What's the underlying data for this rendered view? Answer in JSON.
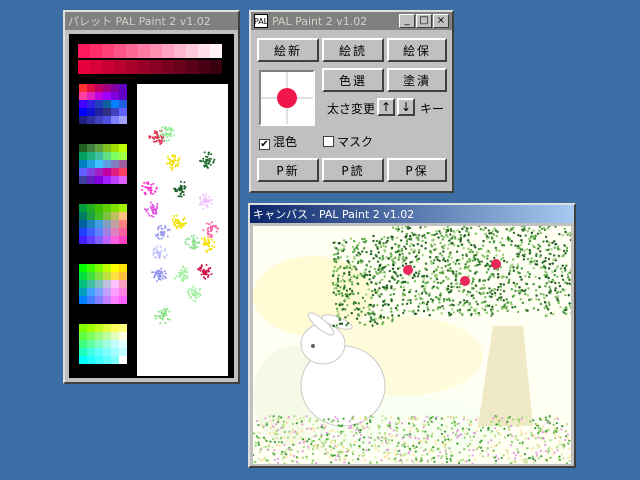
{
  "palette_window": {
    "title": "パレット PAL Paint 2 v1.02",
    "top_strip": [
      "#ff1a5e",
      "#ff2d6b",
      "#ff4079",
      "#ff5487",
      "#ff6795",
      "#ff7ba3",
      "#ff8fb1",
      "#ffa3c0",
      "#ffb7ce",
      "#ffcbdc",
      "#ffdfea",
      "#fff3f8"
    ],
    "bottom_strip": [
      "#e8003c",
      "#d90038",
      "#c90034",
      "#b90030",
      "#a9002c",
      "#990028",
      "#890024",
      "#790020",
      "#69001c",
      "#590018",
      "#490014",
      "#390010"
    ],
    "groups": [
      [
        "#ff3030",
        "#e01040",
        "#c00060",
        "#a00080",
        "#8000a0",
        "#6000c0",
        "#ff40a0",
        "#e020c0",
        "#c000e0",
        "#a000ff",
        "#8000e0",
        "#6000c0",
        "#4000ff",
        "#3020e0",
        "#2040c0",
        "#1060a0",
        "#0080ff",
        "#2060e0",
        "#0000ff",
        "#1010d0",
        "#2020a0",
        "#303080",
        "#4040c0",
        "#6060ff",
        "#202080",
        "#3030a0",
        "#4040c0",
        "#5050e0",
        "#8080ff",
        "#a0a0ff"
      ],
      [
        "#206020",
        "#408040",
        "#60a040",
        "#80c020",
        "#a0e000",
        "#c0ff00",
        "#00a060",
        "#20b080",
        "#40c0a0",
        "#60e080",
        "#80ff60",
        "#a0ff40",
        "#0080c0",
        "#20a0e0",
        "#40c0ff",
        "#60a0e0",
        "#8080c0",
        "#a060a0",
        "#6060ff",
        "#8040e0",
        "#a020c0",
        "#c000a0",
        "#e02080",
        "#ff4060",
        "#4040a0",
        "#6020c0",
        "#8000e0",
        "#a020ff",
        "#c040ff",
        "#e060ff"
      ],
      [
        "#00a040",
        "#20b020",
        "#40c000",
        "#60d000",
        "#80e000",
        "#a0f000",
        "#008060",
        "#20a040",
        "#40c020",
        "#80c040",
        "#c0c060",
        "#ffc080",
        "#0060a0",
        "#2080c0",
        "#40a0e0",
        "#80a0c0",
        "#c0a0a0",
        "#ff8080",
        "#2040ff",
        "#4060ff",
        "#6080ff",
        "#a080e0",
        "#e080c0",
        "#ff60a0",
        "#4020ff",
        "#6040ff",
        "#8060ff",
        "#c060ff",
        "#ff60e0",
        "#ff40c0"
      ],
      [
        "#00ff00",
        "#40ff00",
        "#80ff00",
        "#c0ff00",
        "#ffff00",
        "#ffe000",
        "#00e040",
        "#40e040",
        "#80e040",
        "#c0e040",
        "#ffe040",
        "#ffc040",
        "#00c080",
        "#40c0a0",
        "#80c0c0",
        "#c0c0e0",
        "#ffc0ff",
        "#ffa0c0",
        "#00a0c0",
        "#40a0ff",
        "#80a0ff",
        "#c0a0ff",
        "#ffa0ff",
        "#ff80e0",
        "#0080ff",
        "#4080ff",
        "#8080ff",
        "#c080ff",
        "#ff80ff",
        "#ff60ff"
      ],
      [
        "#80ff00",
        "#a0ff00",
        "#c0ff20",
        "#e0ff40",
        "#ffff60",
        "#ffff80",
        "#60ff40",
        "#80ff60",
        "#a0ff80",
        "#c0ffa0",
        "#e0ffc0",
        "#ffffe0",
        "#40ff80",
        "#60ffa0",
        "#80ffc0",
        "#a0ffe0",
        "#c0ffff",
        "#e0ffff",
        "#20ffc0",
        "#40ffe0",
        "#60ffff",
        "#80ffff",
        "#a0ffff",
        "#c0ffff",
        "#00ffff",
        "#20ffff",
        "#40ffff",
        "#60ffff",
        "#80ffff",
        "#ffffff"
      ]
    ],
    "blobs": [
      {
        "color": "#e0284a"
      },
      {
        "color": "#f2e000"
      },
      {
        "color": "#1f6b2e"
      },
      {
        "color": "#ff33cc"
      },
      {
        "color": "#1f5f2a"
      },
      {
        "color": "#e055e0"
      },
      {
        "color": "#f0c0ff"
      },
      {
        "color": "#f2e000"
      },
      {
        "color": "#ff66aa"
      },
      {
        "color": "#a0a0f0"
      },
      {
        "color": "#90e090"
      },
      {
        "color": "#f2e000"
      },
      {
        "color": "#c0c0ff"
      },
      {
        "color": "#a0f0a0"
      },
      {
        "color": "#d01040"
      },
      {
        "color": "#9090f0"
      },
      {
        "color": "#a0f0a0"
      },
      {
        "color": "#80e080"
      },
      {
        "color": "#90ee90"
      }
    ]
  },
  "main_window": {
    "title": "PAL Paint 2 v1.02",
    "icon_label": "PAL",
    "buttons": {
      "new_pic": "絵新",
      "load_pic": "絵読",
      "save_pic": "絵保",
      "color_select": "色選",
      "fill": "塗潰",
      "new_pal": "P新",
      "load_pal": "P読",
      "save_pal": "P保"
    },
    "size_change_label": "太さ変更",
    "arrow_up": "↑",
    "arrow_down": "↓",
    "key_label": "キー",
    "mix_label": "混色",
    "mask_label": "マスク",
    "mix_checked": true,
    "mask_checked": false,
    "current_color": "#f0184a"
  },
  "canvas_window": {
    "title": "キャンバス - PAL Paint 2 v1.02"
  },
  "window_controls": {
    "minimize": "_",
    "maximize": "□",
    "close": "×"
  }
}
